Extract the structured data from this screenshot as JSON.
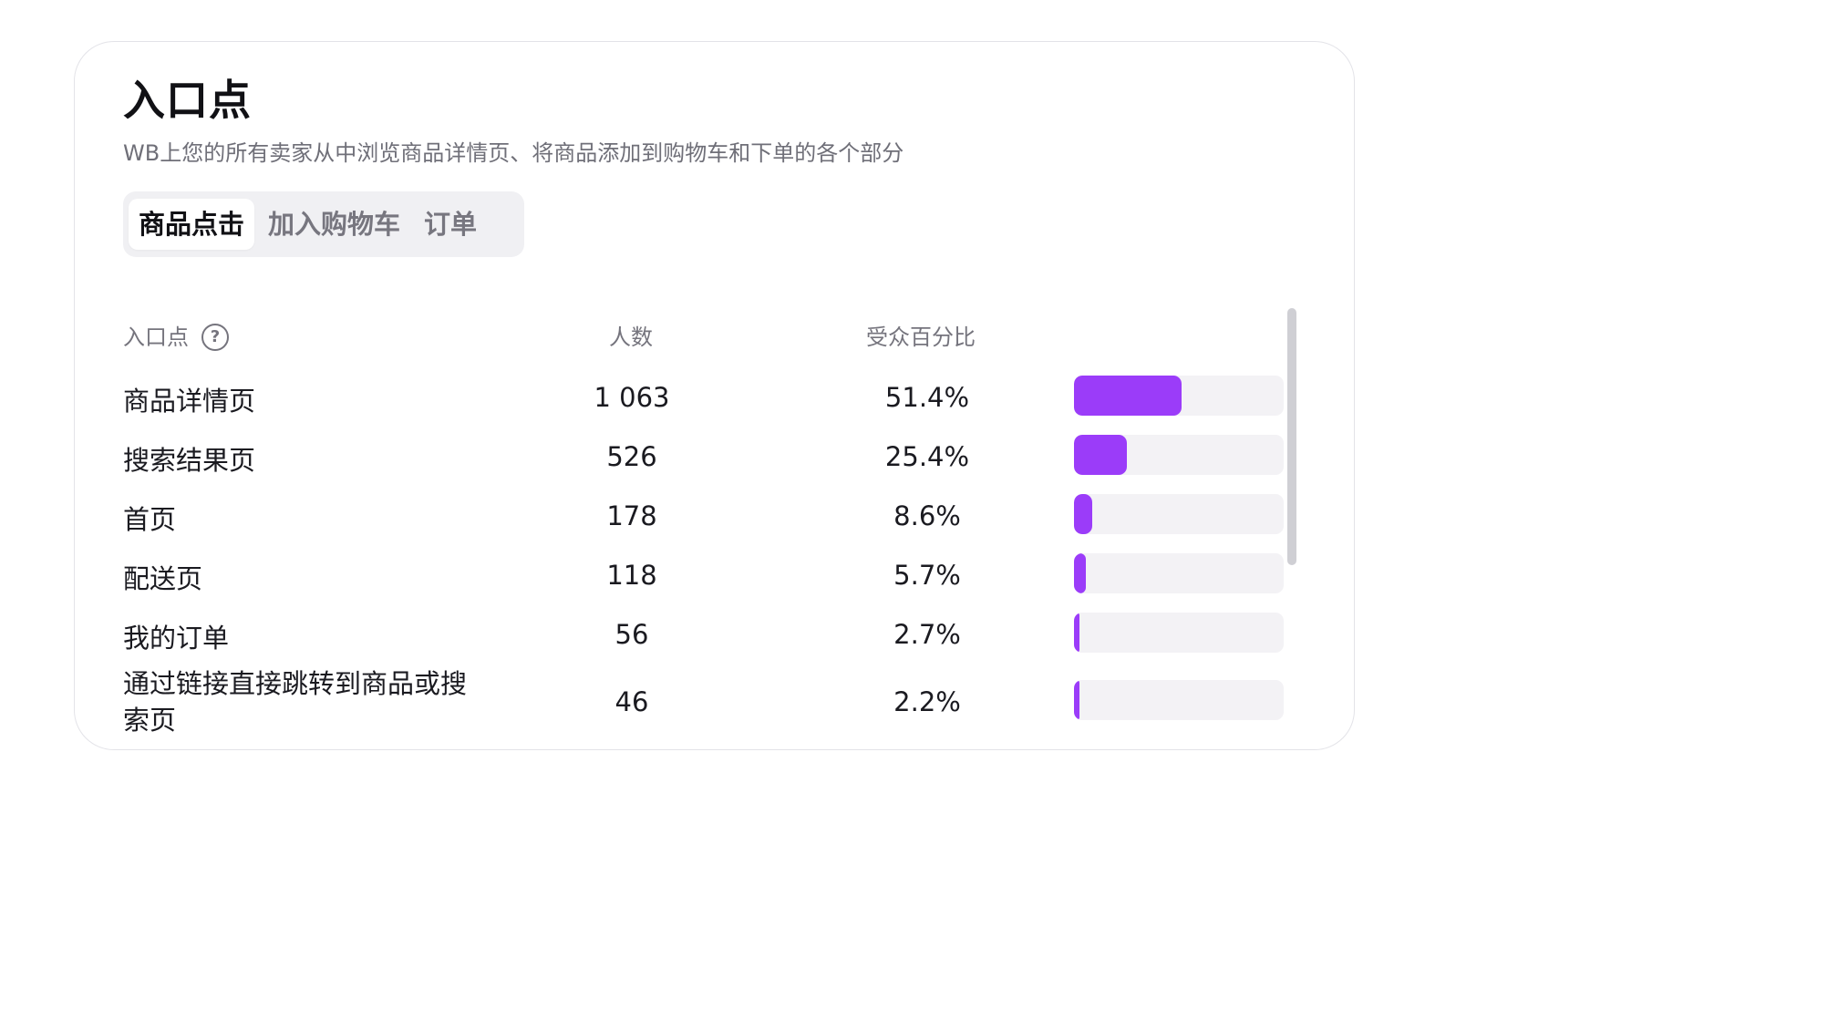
{
  "card": {
    "title": "入口点",
    "subtitle": "WB上您的所有卖家从中浏览商品详情页、将商品添加到购物车和下单的各个部分"
  },
  "tabs": [
    {
      "label": "商品点击",
      "active": true
    },
    {
      "label": "加入购物车",
      "active": false
    },
    {
      "label": "订单",
      "active": false
    }
  ],
  "table": {
    "headers": {
      "entry": "入口点",
      "count": "人数",
      "percent": "受众百分比"
    },
    "help_icon": "question-circle-icon",
    "rows": [
      {
        "name": "商品详情页",
        "count": "1 063",
        "percent": "51.4%",
        "share": 0.514
      },
      {
        "name": "搜索结果页",
        "count": "526",
        "percent": "25.4%",
        "share": 0.254
      },
      {
        "name": "首页",
        "count": "178",
        "percent": "8.6%",
        "share": 0.086
      },
      {
        "name": "配送页",
        "count": "118",
        "percent": "5.7%",
        "share": 0.057
      },
      {
        "name": "我的订单",
        "count": "56",
        "percent": "2.7%",
        "share": 0.027
      },
      {
        "name": "通过链接直接跳转到商品或搜索页",
        "count": "46",
        "percent": "2.2%",
        "share": 0.022
      }
    ]
  },
  "colors": {
    "bar_fill": "#9b3cf9",
    "bar_track": "#f3f2f5",
    "tab_bg": "#f0f0f3"
  }
}
